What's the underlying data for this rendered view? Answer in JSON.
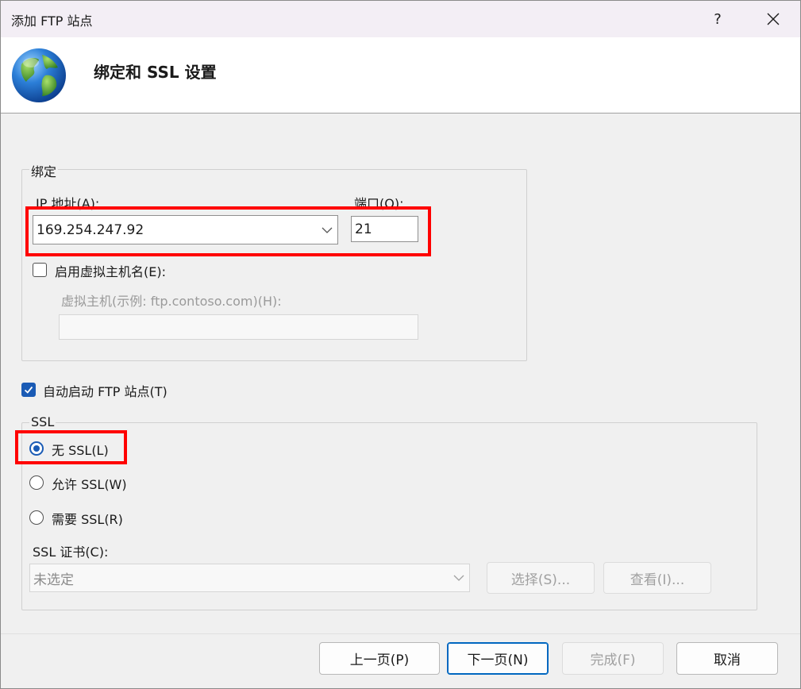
{
  "window": {
    "title": "添加 FTP 站点",
    "help_label": "?"
  },
  "header": {
    "heading": "绑定和 SSL 设置",
    "icon": "globe-icon"
  },
  "binding": {
    "group_title": "绑定",
    "ip_label": "IP 地址(A):",
    "ip_value": "169.254.247.92",
    "port_label": "端口(O):",
    "port_value": "21",
    "virtual_host_checkbox_label": "启用虚拟主机名(E):",
    "virtual_host_checked": false,
    "virtual_host_label": "虚拟主机(示例: ftp.contoso.com)(H):",
    "virtual_host_value": ""
  },
  "auto_start": {
    "label": "自动启动 FTP 站点(T)",
    "checked": true
  },
  "ssl": {
    "group_title": "SSL",
    "options": [
      {
        "label": "无 SSL(L)",
        "selected": true
      },
      {
        "label": "允许 SSL(W)",
        "selected": false
      },
      {
        "label": "需要 SSL(R)",
        "selected": false
      }
    ],
    "cert_label": "SSL 证书(C):",
    "cert_value": "未选定",
    "select_button": "选择(S)...",
    "view_button": "查看(I)..."
  },
  "footer": {
    "prev_button": "上一页(P)",
    "next_button": "下一页(N)",
    "finish_button": "完成(F)",
    "cancel_button": "取消"
  },
  "colors": {
    "accent": "#1a5bb5",
    "highlight": "#ff0000",
    "titlebar": "#f3eef5"
  }
}
